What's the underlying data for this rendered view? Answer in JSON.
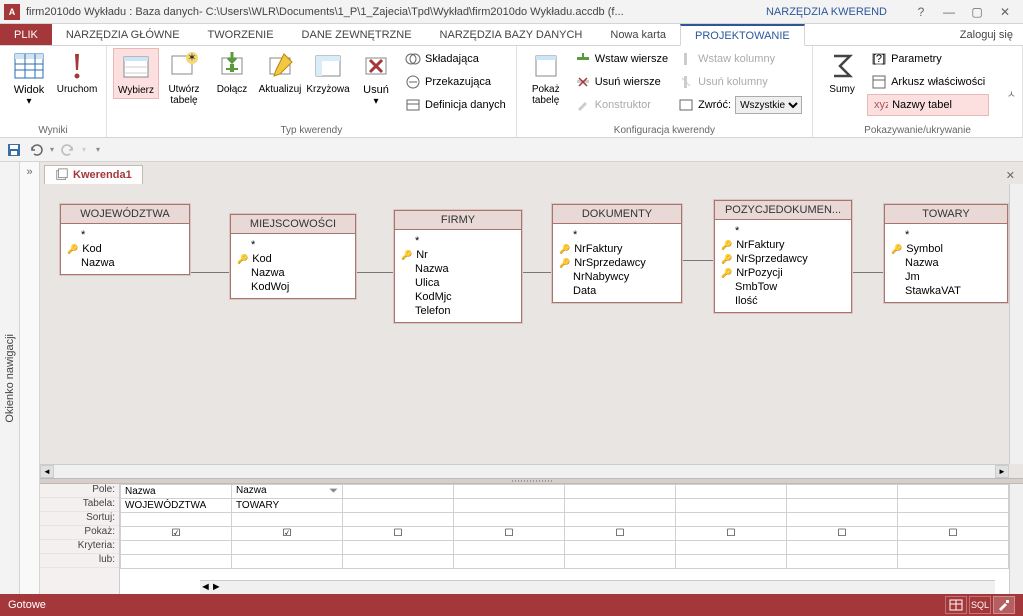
{
  "title_bar": {
    "app_icon": "A",
    "text": "firm2010do Wykładu : Baza danych- C:\\Users\\WLR\\Documents\\1_P\\1_Zajecia\\Tpd\\Wykład\\firm2010do Wykładu.accdb (f...",
    "context_title": "NARZĘDZIA KWEREND",
    "help": "?"
  },
  "tabs": {
    "file": "PLIK",
    "items": [
      "NARZĘDZIA GŁÓWNE",
      "TWORZENIE",
      "DANE ZEWNĘTRZNE",
      "NARZĘDZIA BAZY DANYCH",
      "Nowa karta"
    ],
    "context": "PROJEKTOWANIE",
    "login": "Zaloguj się"
  },
  "ribbon": {
    "wyniki": {
      "label": "Wyniki",
      "widok": "Widok",
      "uruchom": "Uruchom"
    },
    "typ": {
      "label": "Typ kwerendy",
      "wybierz": "Wybierz",
      "utworz": "Utwórz tabelę",
      "dolacz": "Dołącz",
      "aktualizuj": "Aktualizuj",
      "krzyzowa": "Krzyżowa",
      "usun": "Usuń",
      "skladajaca": "Składająca",
      "przekazujaca": "Przekazująca",
      "definicja": "Definicja danych"
    },
    "konfig": {
      "label": "Konfiguracja kwerendy",
      "pokaz": "Pokaż tabelę",
      "wstaw_w": "Wstaw wiersze",
      "usun_w": "Usuń wiersze",
      "konstruktor": "Konstruktor",
      "wstaw_k": "Wstaw kolumny",
      "usun_k": "Usuń kolumny",
      "zwroc": "Zwróć:",
      "zwroc_val": "Wszystkie"
    },
    "pokaz": {
      "label": "Pokazywanie/ukrywanie",
      "sumy": "Sumy",
      "parametry": "Parametry",
      "arkusz": "Arkusz właściwości",
      "nazwy": "Nazwy tabel"
    }
  },
  "nav_pane": "Okienko nawigacji",
  "doc_tab": "Kwerenda1",
  "tables": {
    "wojewodztwa": {
      "title": "WOJEWÓDZTWA",
      "fields": [
        "*",
        "Kod",
        "Nazwa"
      ],
      "keys": [
        1
      ]
    },
    "miejscowosci": {
      "title": "MIEJSCOWOŚCI",
      "fields": [
        "*",
        "Kod",
        "Nazwa",
        "KodWoj"
      ],
      "keys": [
        1
      ]
    },
    "firmy": {
      "title": "FIRMY",
      "fields": [
        "*",
        "Nr",
        "Nazwa",
        "Ulica",
        "KodMjc",
        "Telefon"
      ],
      "keys": [
        1
      ]
    },
    "dokumenty": {
      "title": "DOKUMENTY",
      "fields": [
        "*",
        "NrFaktury",
        "NrSprzedawcy",
        "NrNabywcy",
        "Data"
      ],
      "keys": [
        1,
        2
      ]
    },
    "pozycje": {
      "title": "POZYCJEDOKUMEN...",
      "fields": [
        "*",
        "NrFaktury",
        "NrSprzedawcy",
        "NrPozycji",
        "SmbTow",
        "Ilość"
      ],
      "keys": [
        1,
        2,
        3
      ]
    },
    "towary": {
      "title": "TOWARY",
      "fields": [
        "*",
        "Symbol",
        "Nazwa",
        "Jm",
        "StawkaVAT"
      ],
      "keys": [
        1
      ]
    }
  },
  "grid": {
    "rows": [
      "Pole:",
      "Tabela:",
      "Sortuj:",
      "Pokaż:",
      "Kryteria:",
      "lub:"
    ],
    "cols": [
      {
        "pole": "Nazwa",
        "tabela": "WOJEWÓDZTWA",
        "pokaz": true
      },
      {
        "pole": "Nazwa",
        "tabela": "TOWARY",
        "pokaz": true
      },
      {
        "pole": "",
        "tabela": "",
        "pokaz": false
      },
      {
        "pole": "",
        "tabela": "",
        "pokaz": false
      },
      {
        "pole": "",
        "tabela": "",
        "pokaz": false
      },
      {
        "pole": "",
        "tabela": "",
        "pokaz": false
      },
      {
        "pole": "",
        "tabela": "",
        "pokaz": false
      },
      {
        "pole": "",
        "tabela": "",
        "pokaz": false
      }
    ]
  },
  "status": {
    "text": "Gotowe",
    "sql": "SQL"
  }
}
